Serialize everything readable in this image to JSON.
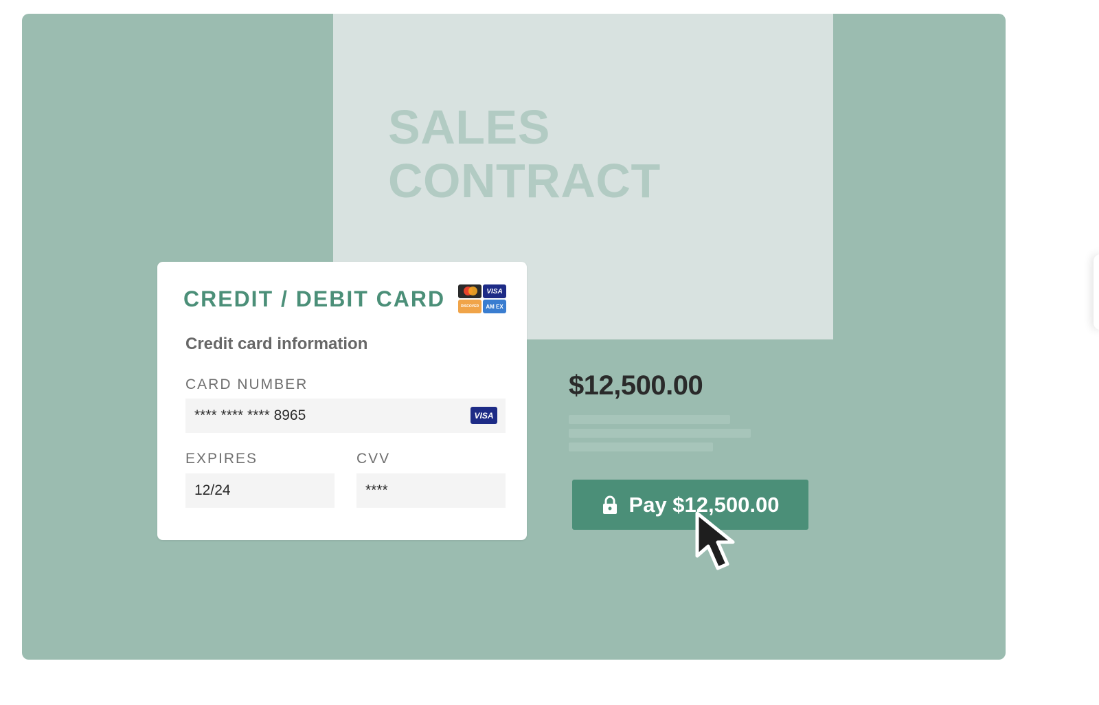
{
  "document": {
    "title": "SALES\nCONTRACT"
  },
  "payment_card": {
    "title": "CREDIT / DEBIT CARD",
    "brands": [
      {
        "icon": "mastercard-icon",
        "label": ""
      },
      {
        "icon": "visa-icon",
        "label": "VISA"
      },
      {
        "icon": "discover-icon",
        "label": "DISCOVER"
      },
      {
        "icon": "amex-icon",
        "label": "AM EX"
      }
    ],
    "section_heading": "Credit card information",
    "card_number": {
      "label": "CARD NUMBER",
      "value": "**** **** **** 8965",
      "badge": "VISA"
    },
    "expires": {
      "label": "EXPIRES",
      "value": "12/24"
    },
    "cvv": {
      "label": "CVV",
      "value": "****"
    }
  },
  "summary": {
    "amount": "$12,500.00"
  },
  "pay_button": {
    "label": "Pay $12,500.00"
  },
  "colors": {
    "stage_bg": "#9bbcb0",
    "document_bg": "#d8e2e0",
    "accent": "#4b8f78",
    "title_faded": "#b2cbc3"
  }
}
